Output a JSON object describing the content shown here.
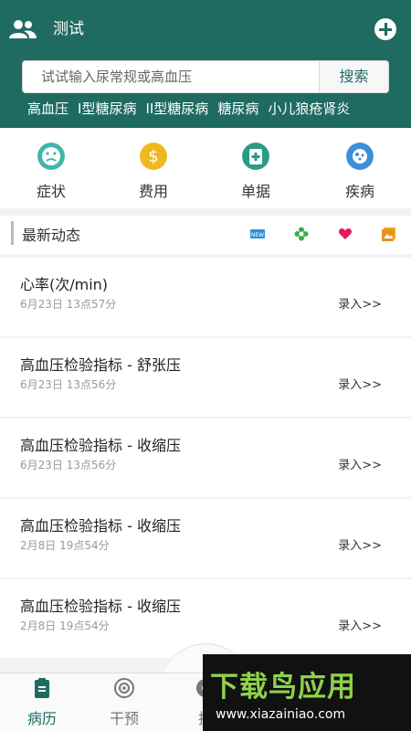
{
  "header": {
    "title": "测试",
    "search_placeholder": "试试输入尿常规或高血压",
    "search_button": "搜索"
  },
  "tags": [
    "高血压",
    "I型糖尿病",
    "II型糖尿病",
    "糖尿病",
    "小儿狼疮肾炎"
  ],
  "categories": [
    {
      "label": "症状",
      "icon": "sad-face-icon",
      "color": "#3fb6a8"
    },
    {
      "label": "费用",
      "icon": "dollar-icon",
      "color": "#f0b820"
    },
    {
      "label": "单据",
      "icon": "medical-kit-icon",
      "color": "#2a9b86"
    },
    {
      "label": "疾病",
      "icon": "virus-icon",
      "color": "#3d8fd8"
    }
  ],
  "news": {
    "title": "最新动态",
    "icons": [
      "new-badge-icon",
      "flower-icon",
      "heart-icon",
      "photo-icon"
    ]
  },
  "feed": [
    {
      "title": "心率(次/min)",
      "time": "6月23日 13点57分",
      "action": "录入>>"
    },
    {
      "title": "高血压检验指标 - 舒张压",
      "time": "6月23日 13点56分",
      "action": "录入>>"
    },
    {
      "title": "高血压检验指标 - 收缩压",
      "time": "6月23日 13点56分",
      "action": "录入>>"
    },
    {
      "title": "高血压检验指标 - 收缩压",
      "time": "2月8日 19点54分",
      "action": "录入>>"
    },
    {
      "title": "高血压检验指标 - 收缩压",
      "time": "2月8日 19点54分",
      "action": "录入>>"
    }
  ],
  "tabs": [
    {
      "label": "病历",
      "icon": "clipboard-icon",
      "active": true
    },
    {
      "label": "干预",
      "icon": "target-icon",
      "active": false
    },
    {
      "label": "拍",
      "icon": "camera-icon",
      "active": false
    }
  ],
  "watermark": {
    "main": "下载鸟应用",
    "url": "www.xiazainiao.com"
  },
  "colors": {
    "primary": "#1f6b62"
  }
}
